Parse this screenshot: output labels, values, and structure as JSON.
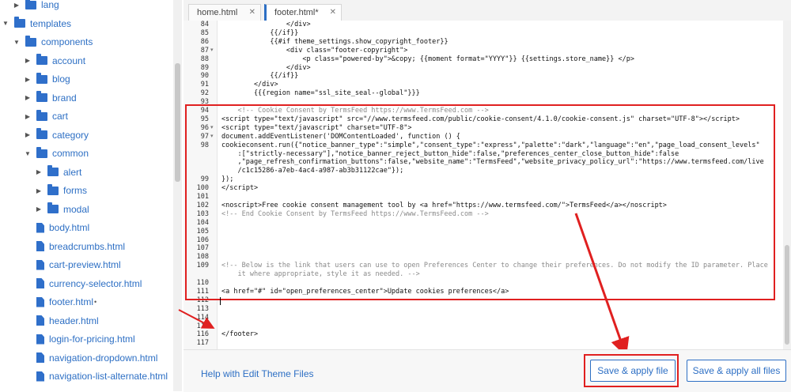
{
  "sidebar": {
    "items": [
      {
        "label": "lang",
        "type": "folder",
        "expand": "collapsed"
      },
      {
        "label": "templates",
        "type": "folder",
        "expand": "expanded"
      },
      {
        "label": "components",
        "type": "folder",
        "expand": "expanded"
      },
      {
        "label": "account",
        "type": "folder",
        "expand": "collapsed"
      },
      {
        "label": "blog",
        "type": "folder",
        "expand": "collapsed"
      },
      {
        "label": "brand",
        "type": "folder",
        "expand": "collapsed"
      },
      {
        "label": "cart",
        "type": "folder",
        "expand": "collapsed"
      },
      {
        "label": "category",
        "type": "folder",
        "expand": "collapsed"
      },
      {
        "label": "common",
        "type": "folder",
        "expand": "expanded"
      },
      {
        "label": "alert",
        "type": "folder",
        "expand": "collapsed"
      },
      {
        "label": "forms",
        "type": "folder",
        "expand": "collapsed"
      },
      {
        "label": "modal",
        "type": "folder",
        "expand": "collapsed"
      },
      {
        "label": "body.html",
        "type": "file"
      },
      {
        "label": "breadcrumbs.html",
        "type": "file"
      },
      {
        "label": "cart-preview.html",
        "type": "file"
      },
      {
        "label": "currency-selector.html",
        "type": "file"
      },
      {
        "label": "footer.html",
        "type": "file",
        "modified_mark": "•"
      },
      {
        "label": "header.html",
        "type": "file"
      },
      {
        "label": "login-for-pricing.html",
        "type": "file"
      },
      {
        "label": "navigation-dropdown.html",
        "type": "file"
      },
      {
        "label": "navigation-list-alternate.html",
        "type": "file"
      }
    ]
  },
  "tabs": [
    {
      "label": "home.html",
      "close": "✕"
    },
    {
      "label": "footer.html*",
      "close": "✕"
    }
  ],
  "editor": {
    "lines": [
      {
        "n": "84",
        "fold": "",
        "text": "                </div>"
      },
      {
        "n": "85",
        "fold": "",
        "text": "            {{/if}}"
      },
      {
        "n": "86",
        "fold": "",
        "text": "            {{#if theme_settings.show_copyright_footer}}"
      },
      {
        "n": "87",
        "fold": "▾",
        "text": "                <div class=\"footer-copyright\">"
      },
      {
        "n": "88",
        "fold": "",
        "text": "                    <p class=\"powered-by\">&copy; {{moment format=\"YYYY\"}} {{settings.store_name}} </p>"
      },
      {
        "n": "89",
        "fold": "",
        "text": "                </div>"
      },
      {
        "n": "90",
        "fold": "",
        "text": "            {{/if}}"
      },
      {
        "n": "91",
        "fold": "",
        "text": "        </div>"
      },
      {
        "n": "92",
        "fold": "",
        "text": "        {{{region name=\"ssl_site_seal--global\"}}}"
      },
      {
        "n": "93",
        "fold": "",
        "text": ""
      },
      {
        "n": "94",
        "fold": "",
        "text": "    <!-- Cookie Consent by TermsFeed https://www.TermsFeed.com -->",
        "comment": true
      },
      {
        "n": "95",
        "fold": "",
        "text": "<script type=\"text/javascript\" src=\"//www.termsfeed.com/public/cookie-consent/4.1.0/cookie-consent.js\" charset=\"UTF-8\"></script>"
      },
      {
        "n": "96",
        "fold": "▾",
        "text": "<script type=\"text/javascript\" charset=\"UTF-8\">"
      },
      {
        "n": "97",
        "fold": "▾",
        "text": "document.addEventListener('DOMContentLoaded', function () {"
      },
      {
        "n": "98",
        "fold": "",
        "text": "cookieconsent.run({\"notice_banner_type\":\"simple\",\"consent_type\":\"express\",\"palette\":\"dark\",\"language\":\"en\",\"page_load_consent_levels\""
      },
      {
        "n": "",
        "fold": "",
        "text": "    :[\"strictly-necessary\"],\"notice_banner_reject_button_hide\":false,\"preferences_center_close_button_hide\":false"
      },
      {
        "n": "",
        "fold": "",
        "text": "    ,\"page_refresh_confirmation_buttons\":false,\"website_name\":\"TermsFeed\",\"website_privacy_policy_url\":\"https://www.termsfeed.com/live"
      },
      {
        "n": "",
        "fold": "",
        "text": "    /c1c15286-a7eb-4ac4-a987-ab3b31122cae\"});"
      },
      {
        "n": "99",
        "fold": "",
        "text": "});"
      },
      {
        "n": "100",
        "fold": "",
        "text": "</script>"
      },
      {
        "n": "101",
        "fold": "",
        "text": ""
      },
      {
        "n": "102",
        "fold": "",
        "text": "<noscript>Free cookie consent management tool by <a href=\"https://www.termsfeed.com/\">TermsFeed</a></noscript>"
      },
      {
        "n": "103",
        "fold": "",
        "text": "<!-- End Cookie Consent by TermsFeed https://www.TermsFeed.com -->",
        "comment": true
      },
      {
        "n": "104",
        "fold": "",
        "text": ""
      },
      {
        "n": "105",
        "fold": "",
        "text": ""
      },
      {
        "n": "106",
        "fold": "",
        "text": ""
      },
      {
        "n": "107",
        "fold": "",
        "text": ""
      },
      {
        "n": "108",
        "fold": "",
        "text": ""
      },
      {
        "n": "109",
        "fold": "",
        "text": "<!-- Below is the link that users can use to open Preferences Center to change their preferences. Do not modify the ID parameter. Place",
        "comment": true
      },
      {
        "n": "",
        "fold": "",
        "text": "    it where appropriate, style it as needed. -->",
        "comment": true
      },
      {
        "n": "110",
        "fold": "",
        "text": ""
      },
      {
        "n": "111",
        "fold": "",
        "text": "<a href=\"#\" id=\"open_preferences_center\">Update cookies preferences</a>"
      },
      {
        "n": "112",
        "fold": "",
        "text": ""
      },
      {
        "n": "113",
        "fold": "",
        "text": ""
      },
      {
        "n": "114",
        "fold": "",
        "text": ""
      },
      {
        "n": "115",
        "fold": "",
        "text": ""
      },
      {
        "n": "116",
        "fold": "",
        "text": "</footer>"
      },
      {
        "n": "117",
        "fold": "",
        "text": ""
      }
    ]
  },
  "footer": {
    "help_link": "Help with Edit Theme Files",
    "save_apply_file": "Save & apply file",
    "save_apply_all": "Save & apply all files"
  },
  "colors": {
    "accent": "#2d6fc4",
    "highlight": "#e02020"
  }
}
